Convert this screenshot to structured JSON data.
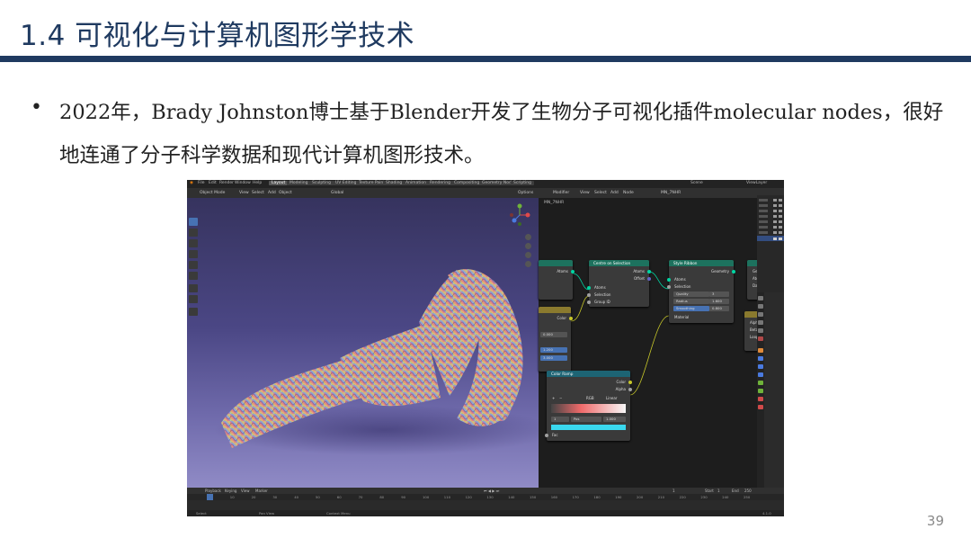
{
  "slide": {
    "title": "1.4 可视化与计算机图形学技术",
    "bullet_marker": "•",
    "bullet_text": "2022年，Brady Johnston博士基于Blender开发了生物分子可视化插件molecular nodes，很好地连通了分子科学数据和现代计算机图形技术。",
    "page_number": "39"
  },
  "colors": {
    "title": "#1f3a60",
    "rule": "#1f3a60",
    "accent": "#4772b3"
  },
  "blender": {
    "menu": [
      "File",
      "Edit",
      "Render",
      "Window",
      "Help"
    ],
    "workspaces": [
      "Layout",
      "Modeling",
      "Sculpting",
      "UV Editing",
      "Texture Paint",
      "Shading",
      "Animation",
      "Rendering",
      "Compositing",
      "Geometry Nodes",
      "Scripting"
    ],
    "active_workspace": "Layout",
    "scene_label": "Scene",
    "view_layer_label": "ViewLayer",
    "viewport_header": [
      "Object Mode",
      "View",
      "Select",
      "Add",
      "Object"
    ],
    "viewport_transform": "Global",
    "viewport_options": "Options",
    "node_editor_header": [
      "Modifier",
      "View",
      "Select",
      "Add",
      "Node"
    ],
    "node_tree_name": "MN_7NHR",
    "node_tree_breadcrumb": "MN_7NHR",
    "nodes": {
      "centre": {
        "title": "Centre on Selection",
        "outputs": [
          "Atoms",
          "Offset"
        ],
        "inputs": [
          "Atoms",
          "Selection",
          "Group ID"
        ]
      },
      "style": {
        "title": "Style Ribbon",
        "output": "Geometry",
        "inputs": [
          "Atoms",
          "Selection"
        ],
        "fields": [
          {
            "label": "Quality",
            "value": "3"
          },
          {
            "label": "Radius",
            "value": "1.600"
          },
          {
            "label": "Smoothing",
            "value": "0.800"
          }
        ],
        "material": "Material"
      },
      "color_ramp": {
        "title": "Color Ramp",
        "outputs": [
          "Color",
          "Alpha"
        ],
        "mode": "RGB",
        "interpolation": "Linear",
        "stop_index": "1",
        "stop_label": "Pos",
        "stop_position": "1.000",
        "input": "Fac"
      },
      "left_partial": {
        "output": "Color",
        "value_a": "0.000",
        "value_b": "1.200",
        "value_c": "3.000"
      },
      "right_partial": {
        "rows": [
          "Geometry",
          "Atoms",
          "Data"
        ]
      },
      "right_partial_2": {
        "rows": [
          "Alpha",
          "Beta",
          "Loop"
        ]
      }
    },
    "timeline": {
      "header": [
        "Playback",
        "Keying",
        "View",
        "Marker"
      ],
      "ruler": [
        "1",
        "10",
        "20",
        "30",
        "40",
        "50",
        "60",
        "70",
        "80",
        "90",
        "100",
        "110",
        "120",
        "130",
        "140",
        "150",
        "160",
        "170",
        "180",
        "190",
        "200",
        "210",
        "220",
        "230",
        "240",
        "250"
      ],
      "current_frame": "1",
      "start_label": "Start",
      "start_value": "1",
      "end_label": "End",
      "end_value": "250"
    },
    "status_bar": [
      "Select",
      "Pan View",
      "Context Menu"
    ],
    "version": "4.1.0"
  }
}
